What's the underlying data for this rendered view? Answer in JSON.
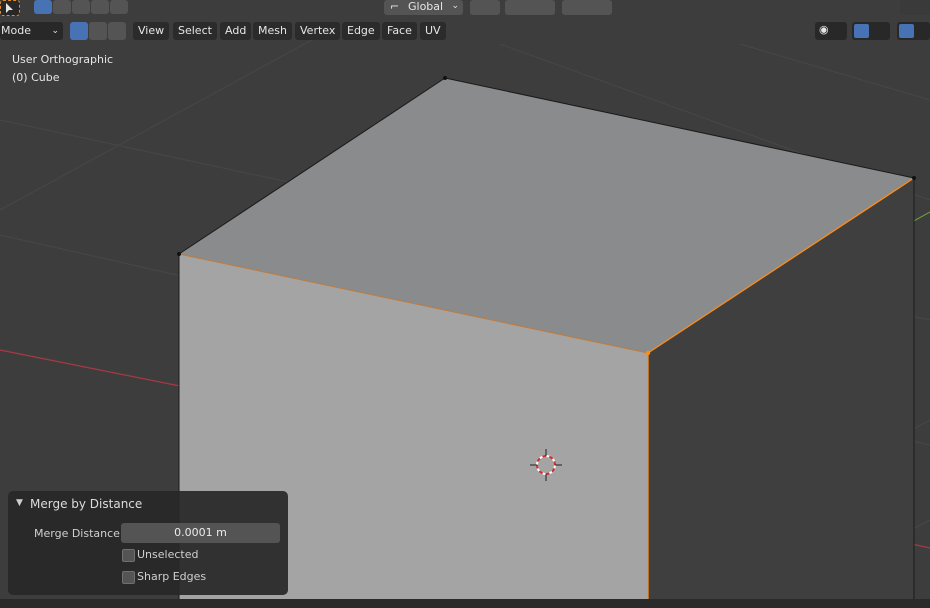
{
  "header": {
    "mode_label": "Mode",
    "transform_orientation": "Global",
    "menu": {
      "view": "View",
      "select": "Select",
      "add": "Add",
      "mesh": "Mesh",
      "vertex": "Vertex",
      "edge": "Edge",
      "face": "Face",
      "uv": "UV"
    }
  },
  "viewport": {
    "view_name": "User Orthographic",
    "object_name": "(0) Cube"
  },
  "operator_panel": {
    "title": "Merge by Distance",
    "merge_distance_label": "Merge Distance",
    "merge_distance_value": "0.0001 m",
    "unselected_label": "Unselected",
    "unselected_checked": false,
    "sharp_edges_label": "Sharp Edges",
    "sharp_edges_checked": false
  },
  "colors": {
    "viewport_bg": "#3d3d3d",
    "accent_blue": "#4772b3",
    "selection_orange": "#ff8c1a",
    "x_axis_red": "#a83a45",
    "y_axis_green": "#6b9a3a"
  },
  "icons": [
    "select-cursor-icon",
    "select-box-icon",
    "orientation-icon",
    "pivot-icon",
    "snap-icon",
    "proportional-icon",
    "falloff-icon",
    "visibility-icon",
    "gizmo-icon",
    "overlay-icon",
    "cursor-3d-icon"
  ]
}
